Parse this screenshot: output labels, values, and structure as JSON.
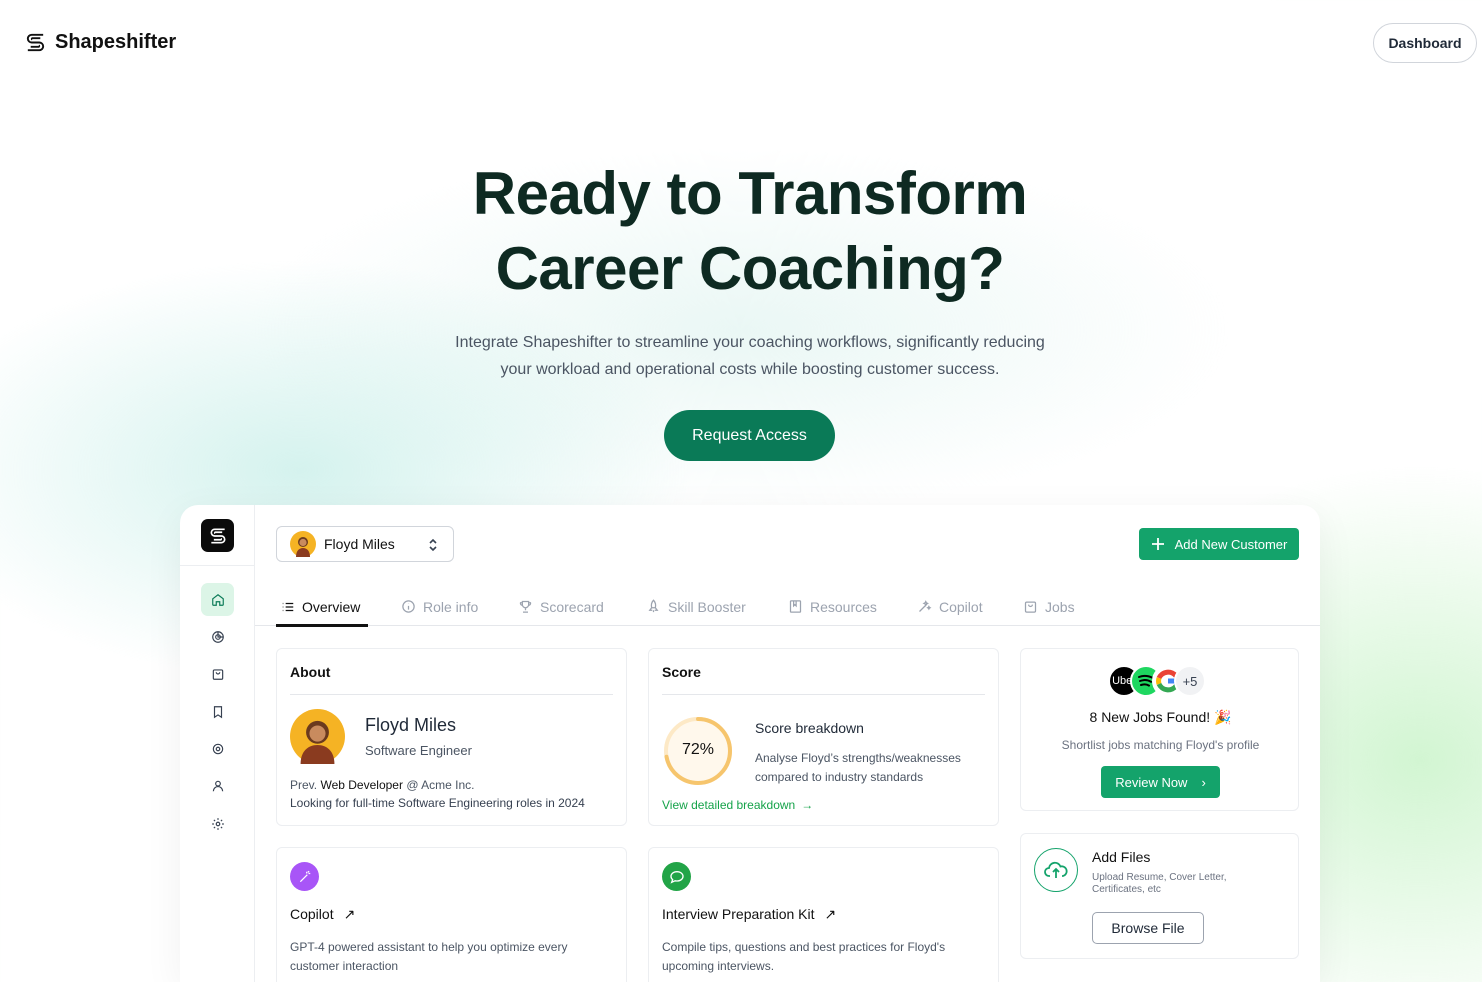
{
  "brand": {
    "name": "Shapeshifter",
    "icon": "shapeshifter-logo-icon"
  },
  "nav": {
    "dashboard_label": "Dashboard"
  },
  "hero": {
    "title_line1": "Ready to Transform",
    "title_line2": "Career Coaching?",
    "subtitle_line1": "Integrate Shapeshifter to streamline your coaching workflows, significantly reducing",
    "subtitle_line2": "your workload and operational costs while boosting customer success.",
    "cta_label": "Request Access"
  },
  "app": {
    "sidebar_icons": [
      "home-icon",
      "analytics-icon",
      "bag-icon",
      "bookmark-icon",
      "eye-settings-icon",
      "user-icon",
      "settings-icon"
    ],
    "customer": {
      "name": "Floyd Miles"
    },
    "add_customer_label": "Add New Customer",
    "tabs": [
      {
        "label": "Overview",
        "icon": "list-icon",
        "active": true
      },
      {
        "label": "Role info",
        "icon": "info-icon"
      },
      {
        "label": "Scorecard",
        "icon": "trophy-icon"
      },
      {
        "label": "Skill Booster",
        "icon": "rocket-icon"
      },
      {
        "label": "Resources",
        "icon": "book-icon"
      },
      {
        "label": "Copilot",
        "icon": "magic-wand-icon"
      },
      {
        "label": "Jobs",
        "icon": "bag-icon"
      }
    ],
    "about": {
      "title": "About",
      "name": "Floyd Miles",
      "role": "Software Engineer",
      "prev_prefix": "Prev.",
      "prev_role": "Web Developer",
      "prev_suffix": "@ Acme Inc.",
      "looking": "Looking for full-time Software Engineering roles in 2024"
    },
    "score": {
      "title": "Score",
      "value": 72,
      "value_label": "72%",
      "breakdown_title": "Score breakdown",
      "breakdown_line1": "Analyse Floyd’s strengths/weaknesses",
      "breakdown_line2": "compared to industry standards",
      "link": "View detailed breakdown",
      "link_arrow": "→"
    },
    "jobs": {
      "more_count": "+5",
      "logos": [
        "uber-logo-icon",
        "spotify-logo-icon",
        "google-logo-icon"
      ],
      "uber_text": "Uber",
      "title": "8 New Jobs Found!",
      "emoji": "🎉",
      "subtitle": "Shortlist jobs matching Floyd's profile",
      "button": "Review Now",
      "button_arrow": "›"
    },
    "copilot": {
      "title": "Copilot",
      "arrow": "↗",
      "line1": "GPT-4 powered assistant to help you optimize every",
      "line2": "customer interaction"
    },
    "interview": {
      "title": "Interview Preparation Kit",
      "arrow": "↗",
      "line1": "Compile tips, questions and best practices for Floyd's",
      "line2": "upcoming interviews."
    },
    "files": {
      "title": "Add Files",
      "line1": "Upload Resume, Cover Letter,",
      "line2": "Certificates, etc",
      "button": "Browse File"
    }
  },
  "colors": {
    "accent": "#0a7a57",
    "accent_light": "#14a36b",
    "heading": "#0e2a22"
  }
}
